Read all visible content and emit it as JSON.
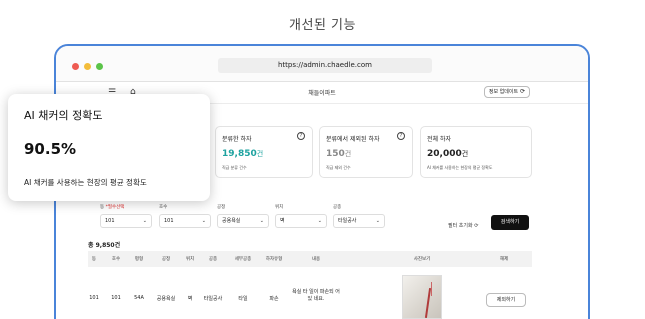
{
  "heading": "개선된 기능",
  "browser": {
    "url": "https://admin.chaedle.com"
  },
  "appbar": {
    "title": "채들이파트",
    "update_label": "정보 업데이트"
  },
  "ai_card": {
    "title": "AI 채커의 정확도",
    "value": "90.5%",
    "description": "AI 채커를 사용하는 현장의 평균 정확도"
  },
  "cards": [
    {
      "title": "분류한 하자",
      "value": "19,850",
      "unit": "건",
      "sub": "직급 분류 건수",
      "color": "#1ea3a0"
    },
    {
      "title": "분류에서 제외된 하자",
      "value": "150",
      "unit": "건",
      "sub": "직급 제외 건수",
      "color": "#888888"
    },
    {
      "title": "전체 하자",
      "value": "20,000",
      "unit": "건",
      "sub": "AI 채커를 사용하는 현장의 평균 정확도"
    }
  ],
  "filters": {
    "labels": [
      "동 *필수선택",
      "호수",
      "공정",
      "위치",
      "공종"
    ],
    "required_mark": "*필수선택",
    "values": [
      "101",
      "101",
      "공용욕실",
      "벽",
      "타일공사"
    ],
    "reset_label": "필터 초기화",
    "search_label": "검색하기"
  },
  "table": {
    "total": "총 9,850건",
    "headers": [
      "동",
      "호수",
      "평형",
      "공정",
      "위치",
      "공종",
      "세부공종",
      "하자유형",
      "내용",
      "사진보기",
      "해제"
    ],
    "row": {
      "cells": [
        "101",
        "101",
        "54A",
        "공용욕실",
        "벽",
        "타일공사",
        "타일",
        "파손"
      ],
      "content": "욕실 타 일이 파손되 어 있 네요.",
      "action": "제외하기"
    }
  },
  "colors": {
    "accent_border": "#4a84d9",
    "teal_value": "#1ea3a0",
    "search_button": "#111111"
  }
}
